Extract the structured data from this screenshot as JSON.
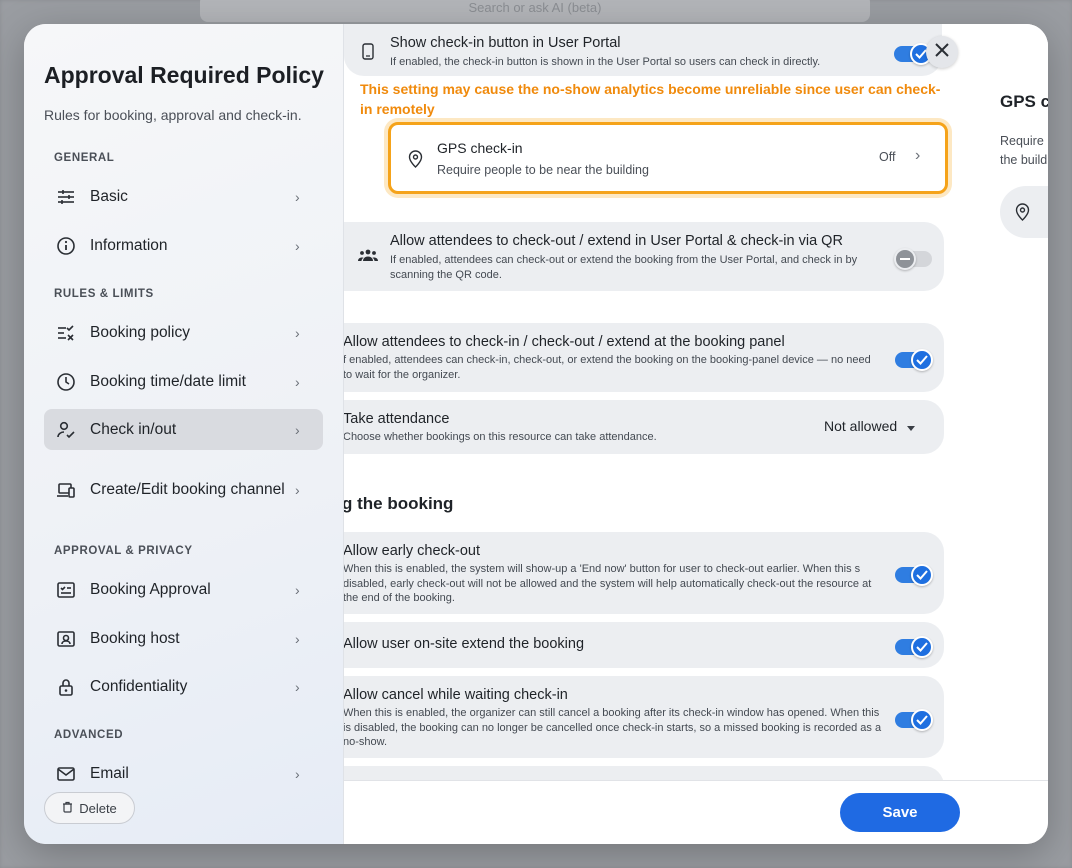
{
  "background": {
    "search_placeholder": "Search or ask AI (beta)"
  },
  "sidebar": {
    "title": "Approval Required Policy",
    "subtitle": "Rules for booking, approval and check-in.",
    "sections": {
      "general": "GENERAL",
      "rules": "RULES & LIMITS",
      "approval": "APPROVAL & PRIVACY",
      "advanced": "ADVANCED"
    },
    "items": [
      {
        "label": "Basic",
        "icon": "sliders-icon"
      },
      {
        "label": "Information",
        "icon": "info-icon"
      },
      {
        "label": "Booking policy",
        "icon": "policy-list-icon"
      },
      {
        "label": "Booking time/date limit",
        "icon": "clock-icon"
      },
      {
        "label": "Check in/out",
        "icon": "user-check-icon",
        "active": true
      },
      {
        "label": "Create/Edit booking channel",
        "icon": "devices-icon"
      },
      {
        "label": "Booking Approval",
        "icon": "approval-form-icon"
      },
      {
        "label": "Booking host",
        "icon": "host-badge-icon"
      },
      {
        "label": "Confidentiality",
        "icon": "lock-icon"
      },
      {
        "label": "Email",
        "icon": "mail-icon"
      }
    ],
    "delete_label": "Delete"
  },
  "main": {
    "show_checkin": {
      "title": "Show check-in button in User Portal",
      "desc": "If enabled, the check-in button is shown in the User Portal so users can check in directly.",
      "enabled": true
    },
    "warning": "This setting may cause the no-show analytics become unreliable since user can check-in remotely",
    "gps": {
      "title": "GPS check-in",
      "desc": "Require people to be near the building",
      "value": "Off"
    },
    "attendees_portal": {
      "title": "Allow attendees to check-out / extend in User Portal & check-in via QR",
      "desc": "If enabled, attendees can check-out or extend the booking from the User Portal, and check in by scanning the QR code.",
      "enabled": false
    },
    "attendees_panel": {
      "title": "Allow attendees to check-in / check-out / extend at the booking panel",
      "desc": "f enabled, attendees can check-in, check-out, or extend the booking on the booking-panel device — no need to wait for the organizer.",
      "enabled": true
    },
    "attendance": {
      "title": "Take attendance",
      "desc": "Choose whether bookings on this resource can take attendance.",
      "value": "Not allowed"
    },
    "section_heading": "g the booking",
    "early_checkout": {
      "title": "Allow early check-out",
      "desc": "When this is enabled, the system will show-up a 'End now' button for user to check-out earlier. When this s disabled, early check-out will not be allowed and the system will help automatically check-out the resource at the end of the booking.",
      "enabled": true
    },
    "onsite_extend": {
      "title": "Allow user on-site extend the booking",
      "enabled": true
    },
    "cancel_waiting": {
      "title": "Allow cancel while waiting check-in",
      "desc": "When this is enabled, the organizer can still cancel a booking after its check-in window has opened. When this is disabled, the booking can no longer be cancelled once check-in starts, so a missed booking is recorded as a no-show.",
      "enabled": true
    }
  },
  "peek": {
    "title": "GPS c",
    "line1": "Require",
    "line2": "the build"
  },
  "footer": {
    "save_label": "Save"
  },
  "colors": {
    "accent": "#1f6ae3",
    "warning": "#f08a0c",
    "highlight_border": "#f5a31a"
  }
}
